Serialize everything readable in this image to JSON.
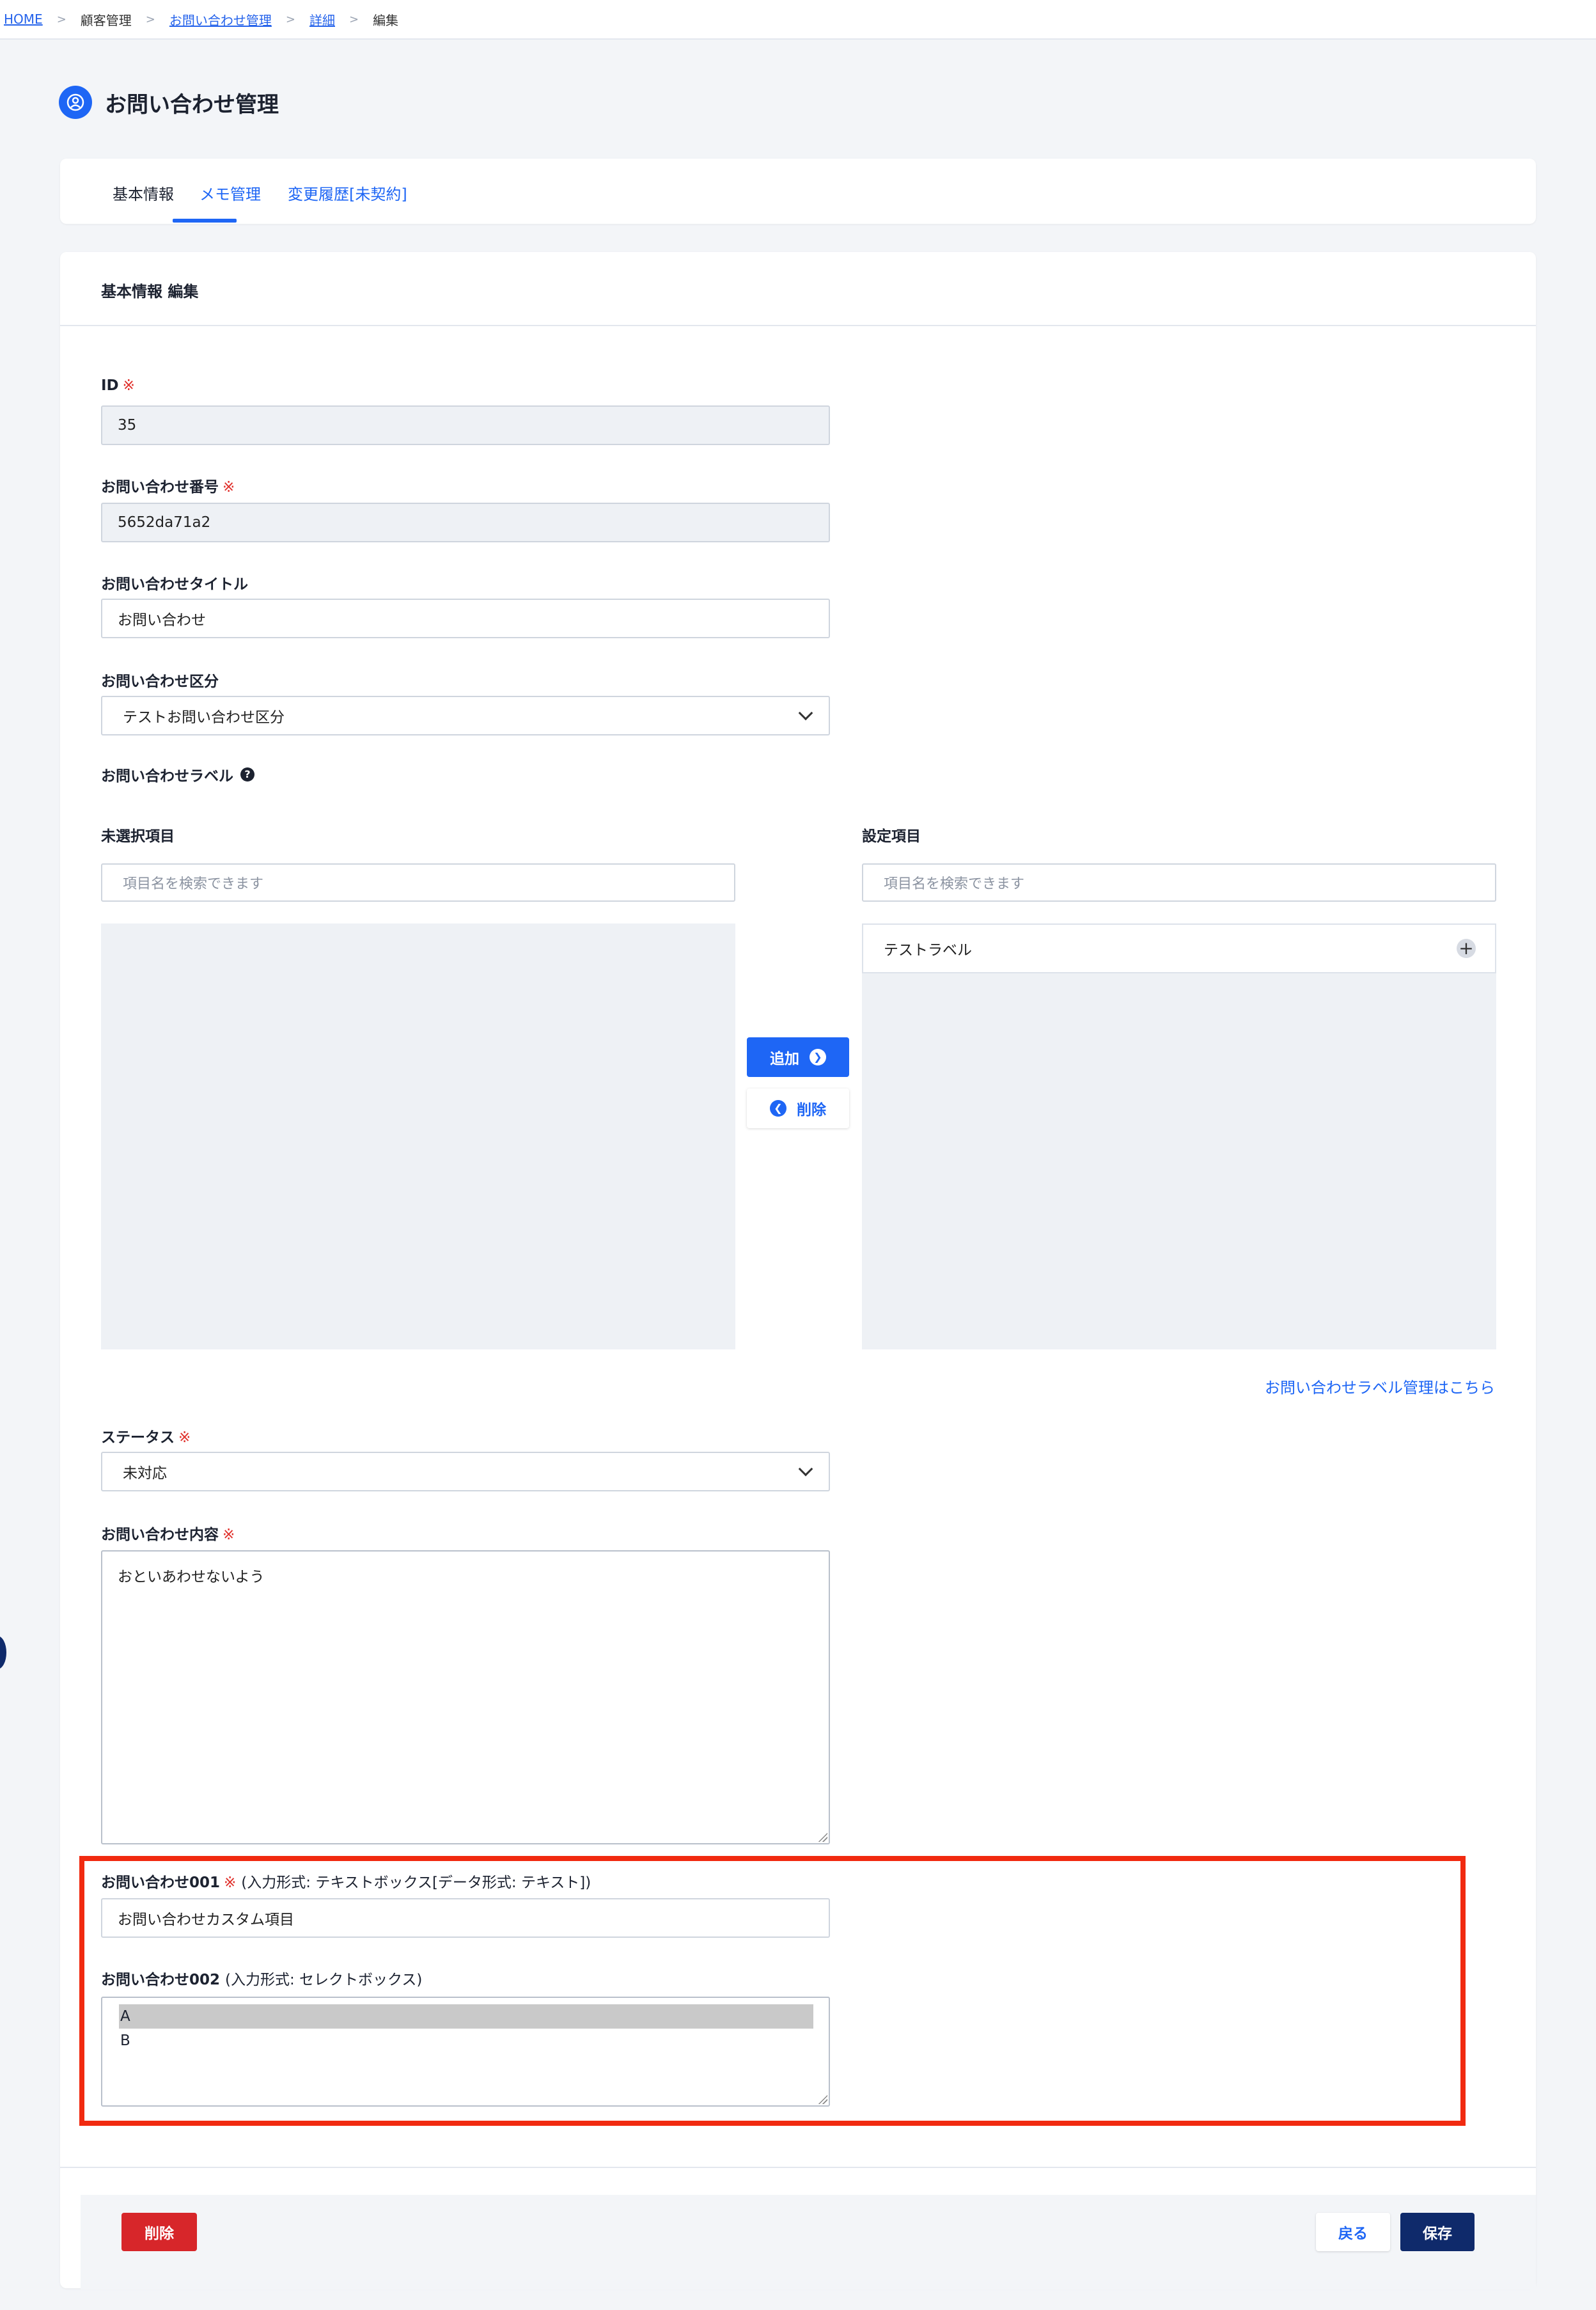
{
  "breadcrumb": {
    "home": "HOME",
    "customer": "顧客管理",
    "inquiry_mgmt": "お問い合わせ管理",
    "detail": "詳細",
    "edit": "編集",
    "separator": ">"
  },
  "page": {
    "title": "お問い合わせ管理",
    "icon": "user-circle-icon"
  },
  "tabs": [
    {
      "label": "基本情報",
      "active": true
    },
    {
      "label": "メモ管理",
      "active": false
    },
    {
      "label": "変更履歴[未契約]",
      "active": false
    }
  ],
  "card": {
    "title": "基本情報 編集"
  },
  "required_mark": "※",
  "fields": {
    "id": {
      "label": "ID",
      "value": "35"
    },
    "number": {
      "label": "お問い合わせ番号",
      "value": "5652da71a2"
    },
    "title": {
      "label": "お問い合わせタイトル",
      "value": "お問い合わせ"
    },
    "category": {
      "label": "お問い合わせ区分",
      "value": "テストお問い合わせ区分"
    },
    "labels": {
      "label": "お問い合わせラベル",
      "unselected_title": "未選択項目",
      "selected_title": "設定項目",
      "search_placeholder": "項目名を検索できます",
      "selected_items": [
        "テストラベル"
      ],
      "add_button": "追加",
      "remove_button": "削除",
      "manage_link": "お問い合わせラベル管理はこちら"
    },
    "status": {
      "label": "ステータス",
      "value": "未対応"
    },
    "content": {
      "label": "お問い合わせ内容",
      "value": "おといあわせないよう"
    },
    "custom001": {
      "label": "お問い合わせ001",
      "note": "(入力形式: テキストボックス[データ形式: テキスト])",
      "value": "お問い合わせカスタム項目"
    },
    "custom002": {
      "label": "お問い合わせ002",
      "note": "(入力形式: セレクトボックス)",
      "options": [
        "A",
        "B"
      ],
      "selected": "A"
    }
  },
  "footer": {
    "delete": "削除",
    "back": "戻る",
    "save": "保存"
  },
  "colors": {
    "primary": "#1e66f5",
    "danger": "#d7262a",
    "navy": "#0f2a6b",
    "highlight": "#f12a10"
  }
}
